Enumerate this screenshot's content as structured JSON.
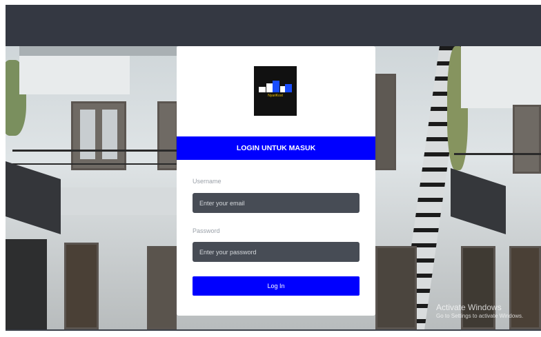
{
  "app": {
    "logo_text": "NyariKost"
  },
  "login": {
    "banner_title": "LOGIN UNTUK MASUK",
    "username_label": "Username",
    "username_placeholder": "Enter your email",
    "username_value": "",
    "password_label": "Password",
    "password_placeholder": "Enter your password",
    "password_value": "",
    "submit_label": "Log In"
  },
  "system": {
    "watermark_title": "Activate Windows",
    "watermark_subtitle": "Go to Settings to activate Windows."
  },
  "colors": {
    "accent": "#0000ff",
    "input_bg": "#474c55",
    "topbar": "#343842",
    "logo_bg": "#111111",
    "logo_text": "#f2c200"
  },
  "icons": {
    "logo": "building-logo-icon"
  }
}
